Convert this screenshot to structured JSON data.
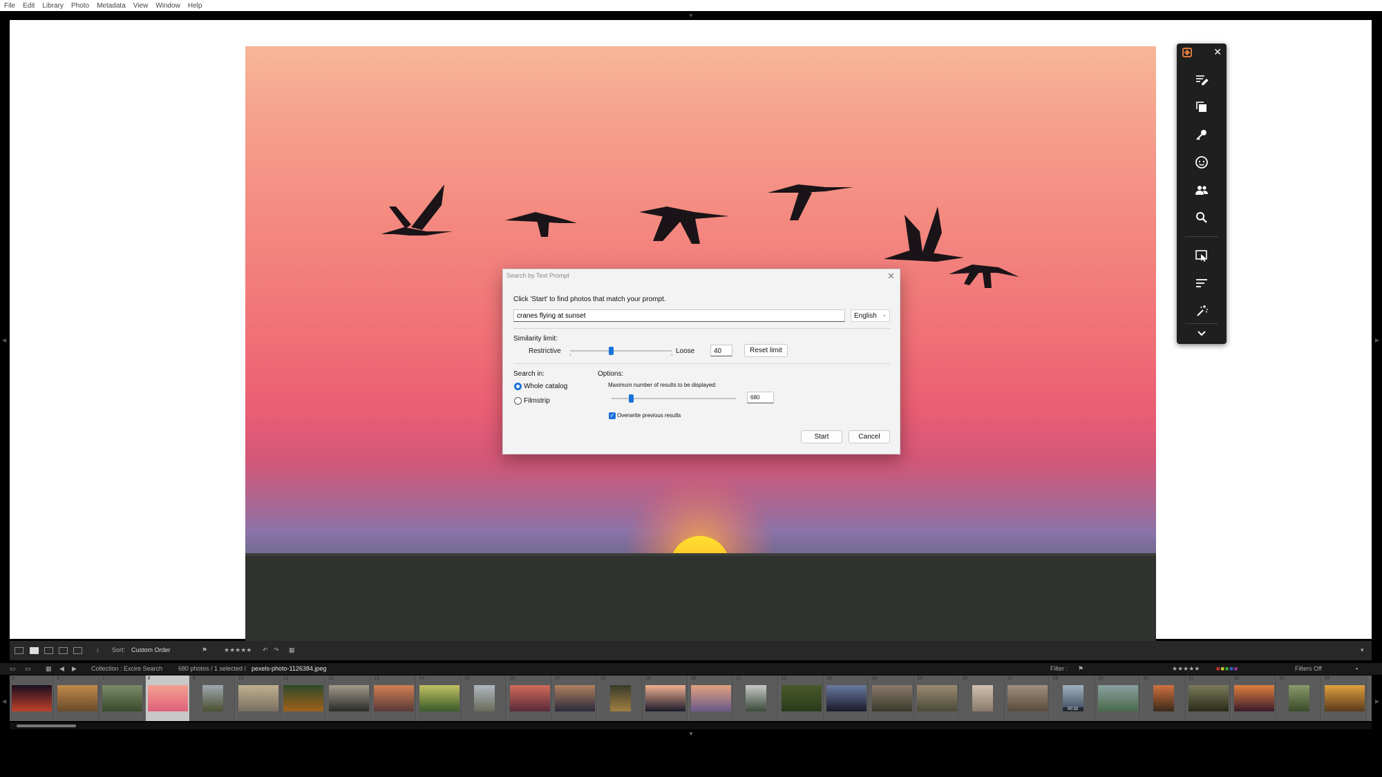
{
  "menu": [
    "File",
    "Edit",
    "Library",
    "Photo",
    "Metadata",
    "View",
    "Window",
    "Help"
  ],
  "toolbar_panel": {
    "icons": [
      "edit-lines-icon",
      "copy-icon",
      "key-icon",
      "face-icon",
      "people-icon",
      "search-icon",
      "image-cursor-icon",
      "sort-lines-icon",
      "magic-wand-icon",
      "chevron-down-icon"
    ]
  },
  "dialog": {
    "title": "Search by Text Prompt",
    "prompt": "Click 'Start' to find photos that match your prompt.",
    "query": "cranes flying at sunset",
    "language": "English",
    "similarity_label": "Similarity limit:",
    "restrictive": "Restrictive",
    "loose": "Loose",
    "similarity_value": "40",
    "similarity_slider_fraction": 0.4,
    "reset_label": "Reset limit",
    "search_in_label": "Search in:",
    "whole_catalog": "Whole catalog",
    "filmstrip": "Filmstrip",
    "options_label": "Options:",
    "max_results_label": "Maximum number of results to be displayed:",
    "max_results_value": "680",
    "overwrite_label": "Overwrite previous results",
    "start": "Start",
    "cancel": "Cancel"
  },
  "toolbar": {
    "sort_label": "Sort:",
    "sort_value": "Custom Order",
    "stars": "★★★★★"
  },
  "filmstrip_header": {
    "collection": "Collection : Excire Search",
    "count": "680 photos / 1 selected /",
    "filename": "pexels-photo-1126384.jpeg",
    "filter_label": "Filter :",
    "filters_off": "Filters Off",
    "stars": "★★★★★"
  },
  "filmstrip": {
    "items": [
      {
        "num": "5",
        "c1": "#1a1020",
        "c2": "#c0402a",
        "portrait": false
      },
      {
        "num": "6",
        "c1": "#c08a4a",
        "c2": "#6a4a2a",
        "portrait": false
      },
      {
        "num": "7",
        "c1": "#7a8a6a",
        "c2": "#3a4a2a",
        "portrait": false
      },
      {
        "num": "8",
        "c1": "#f3a090",
        "c2": "#e0607a",
        "portrait": false
      },
      {
        "num": "9",
        "c1": "#a0a8b0",
        "c2": "#4a5030",
        "portrait": true
      },
      {
        "num": "10",
        "c1": "#c0b090",
        "c2": "#7a7060",
        "portrait": false
      },
      {
        "num": "11",
        "c1": "#304a2a",
        "c2": "#a0601a",
        "portrait": false
      },
      {
        "num": "12",
        "c1": "#a09a8a",
        "c2": "#2a2a2a",
        "portrait": false
      },
      {
        "num": "13",
        "c1": "#d08050",
        "c2": "#5a3a3a",
        "portrait": false
      },
      {
        "num": "14",
        "c1": "#c0c060",
        "c2": "#3a5a2a",
        "portrait": false
      },
      {
        "num": "15",
        "c1": "#b0b8c0",
        "c2": "#6a6a5a",
        "portrait": true
      },
      {
        "num": "16",
        "c1": "#d06a5a",
        "c2": "#5a2a3a",
        "portrait": false
      },
      {
        "num": "17",
        "c1": "#b08060",
        "c2": "#2a2a3a",
        "portrait": false
      },
      {
        "num": "18",
        "c1": "#3a3a2a",
        "c2": "#a08040",
        "portrait": true
      },
      {
        "num": "19",
        "c1": "#f0b090",
        "c2": "#1a1a2a",
        "portrait": false
      },
      {
        "num": "20",
        "c1": "#e0a080",
        "c2": "#6a5a8a",
        "portrait": false
      },
      {
        "num": "21",
        "c1": "#c8c8c8",
        "c2": "#3a4a3a",
        "portrait": true
      },
      {
        "num": "22",
        "c1": "#4a5a2a",
        "c2": "#2a3a1a",
        "portrait": false
      },
      {
        "num": "23",
        "c1": "#6a7aa0",
        "c2": "#1a1a2a",
        "portrait": false
      },
      {
        "num": "24",
        "c1": "#8a7a6a",
        "c2": "#3a3a2a",
        "portrait": false
      },
      {
        "num": "25",
        "c1": "#9a8a70",
        "c2": "#4a4a3a",
        "portrait": false
      },
      {
        "num": "26",
        "c1": "#d0c0b0",
        "c2": "#8a7a6a",
        "portrait": true
      },
      {
        "num": "27",
        "c1": "#a09080",
        "c2": "#5a4a3a",
        "portrait": false
      },
      {
        "num": "28",
        "c1": "#a0b0c0",
        "c2": "#3a4a5a",
        "portrait": true,
        "duration": "00:33"
      },
      {
        "num": "29",
        "c1": "#8aa0a0",
        "c2": "#4a6a4a",
        "portrait": false
      },
      {
        "num": "30",
        "c1": "#d07040",
        "c2": "#3a2a1a",
        "portrait": true
      },
      {
        "num": "31",
        "c1": "#7a7a5a",
        "c2": "#2a2a1a",
        "portrait": false
      },
      {
        "num": "32",
        "c1": "#e08040",
        "c2": "#3a1a2a",
        "portrait": false
      },
      {
        "num": "33",
        "c1": "#8a9a6a",
        "c2": "#3a4a2a",
        "portrait": true
      },
      {
        "num": "34",
        "c1": "#e0a040",
        "c2": "#5a3a1a",
        "portrait": false
      }
    ]
  }
}
